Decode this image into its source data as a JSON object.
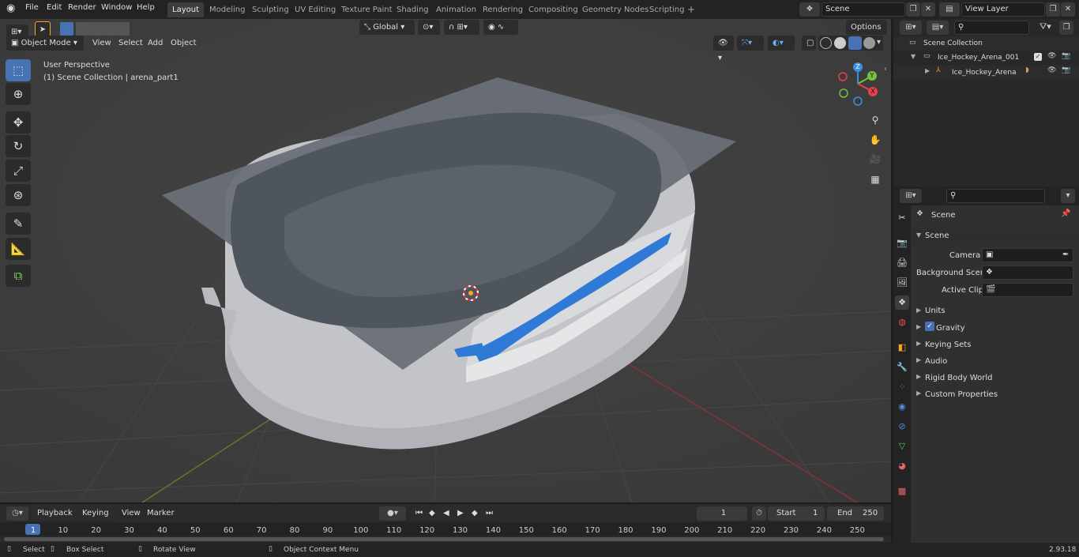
{
  "menu": {
    "file": "File",
    "edit": "Edit",
    "render": "Render",
    "window": "Window",
    "help": "Help"
  },
  "workspaces": [
    "Layout",
    "Modeling",
    "Sculpting",
    "UV Editing",
    "Texture Paint",
    "Shading",
    "Animation",
    "Rendering",
    "Compositing",
    "Geometry Nodes",
    "Scripting"
  ],
  "scene": {
    "name": "Scene"
  },
  "view_layer": {
    "name": "View Layer"
  },
  "viewport": {
    "mode": "Object Mode",
    "menu_view": "View",
    "menu_select": "Select",
    "menu_add": "Add",
    "menu_object": "Object",
    "orientation": "Global",
    "options": "Options",
    "perspective": "User Perspective",
    "collection_info": "(1) Scene Collection | arena_part1",
    "gizmo": {
      "x": "X",
      "y": "Y",
      "z": "Z"
    }
  },
  "outliner": {
    "root": "Scene Collection",
    "collection": "Ice_Hockey_Arena_001",
    "object": "Ice_Hockey_Arena"
  },
  "properties": {
    "header": "Scene",
    "panel": "Scene",
    "camera_label": "Camera",
    "bg_scene_label": "Background Scene",
    "active_clip_label": "Active Clip",
    "sections": [
      "Units",
      "Gravity",
      "Keying Sets",
      "Audio",
      "Rigid Body World",
      "Custom Properties"
    ]
  },
  "timeline": {
    "playback": "Playback",
    "keying": "Keying",
    "view": "View",
    "marker": "Marker",
    "current_frame": "1",
    "start_label": "Start",
    "start": "1",
    "end_label": "End",
    "end": "250",
    "ticks": [
      "1",
      "10",
      "20",
      "30",
      "40",
      "50",
      "60",
      "70",
      "80",
      "90",
      "100",
      "110",
      "120",
      "130",
      "140",
      "150",
      "160",
      "170",
      "180",
      "190",
      "200",
      "210",
      "220",
      "230",
      "240",
      "250"
    ]
  },
  "status": {
    "select": "Select",
    "box_select": "Box Select",
    "rotate": "Rotate View",
    "context_menu": "Object Context Menu",
    "version": "2.93.18"
  },
  "colors": {
    "accent": "#4772b3",
    "x_axis": "#e8404a",
    "y_axis": "#74c13b",
    "z_axis": "#3a8fe0"
  }
}
